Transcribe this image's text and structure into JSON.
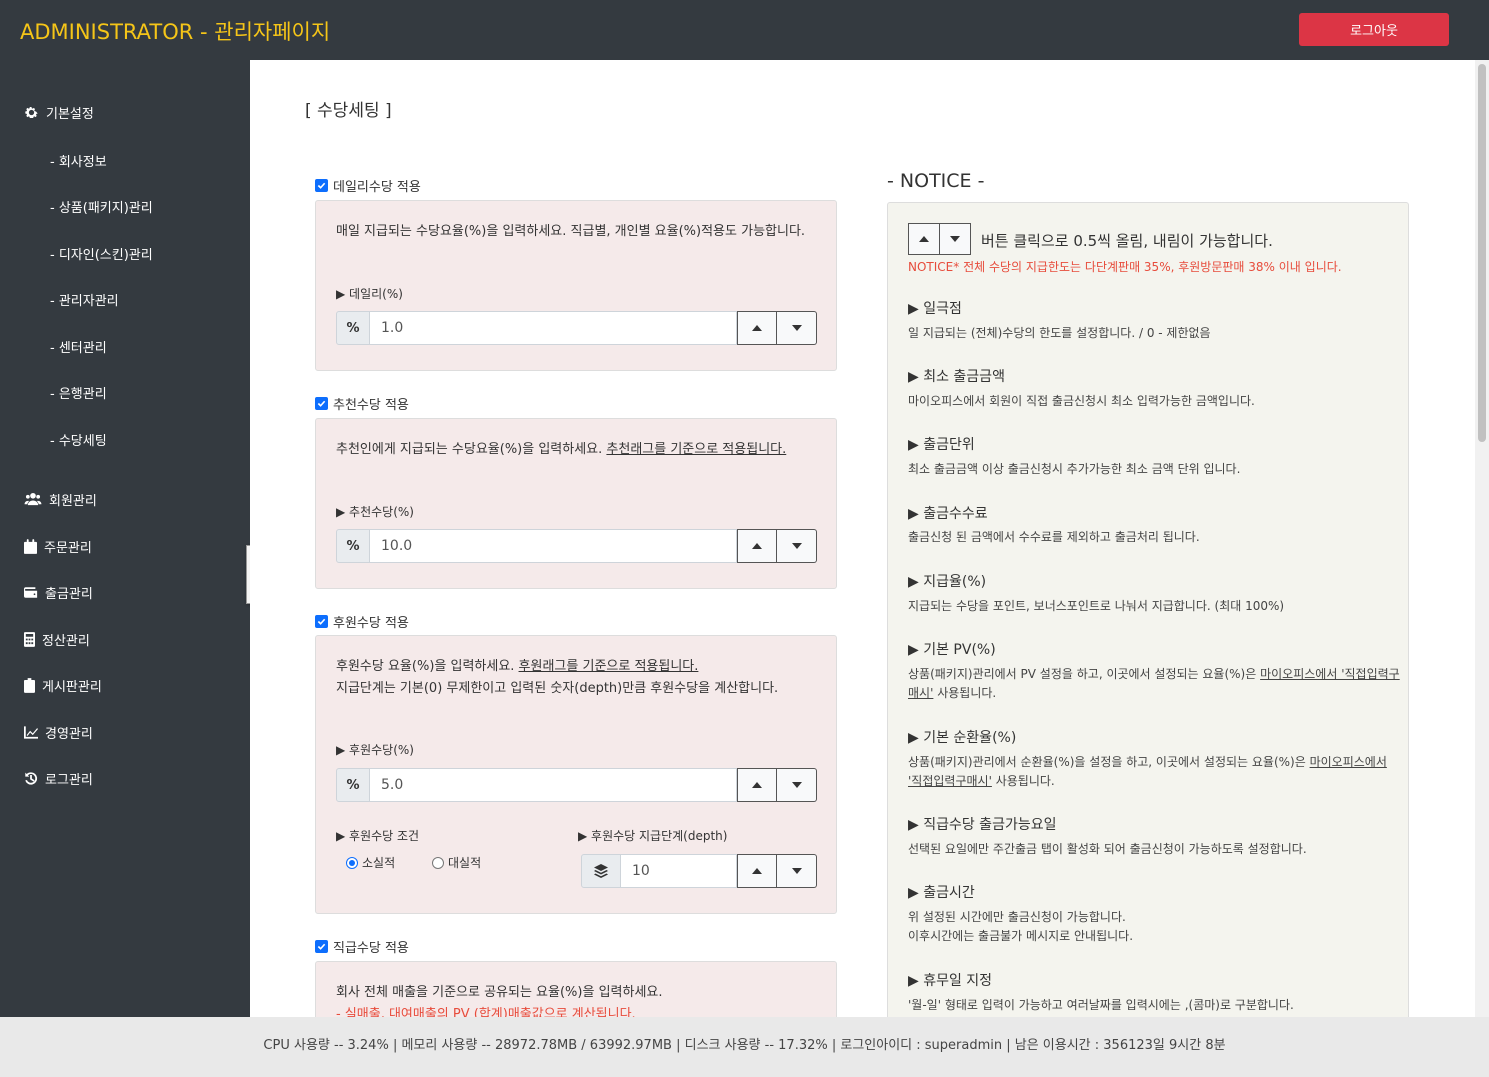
{
  "header": {
    "brand": "ADMINISTRATOR - 관리자페이지",
    "logout_label": "로그아웃"
  },
  "sidebar": {
    "groups": [
      {
        "label": "기본설정",
        "icon": "gear-icon"
      },
      {
        "label": "회원관리",
        "icon": "users-icon"
      },
      {
        "label": "주문관리",
        "icon": "calendar-icon"
      },
      {
        "label": "출금관리",
        "icon": "wallet-icon"
      },
      {
        "label": "정산관리",
        "icon": "calculator-icon"
      },
      {
        "label": "게시판관리",
        "icon": "clipboard-icon"
      },
      {
        "label": "경영관리",
        "icon": "chart-line-icon"
      },
      {
        "label": "로그관리",
        "icon": "history-icon"
      }
    ],
    "sub_items": [
      "- 회사정보",
      "- 상품(패키지)관리",
      "- 디자인(스킨)관리",
      "- 관리자관리",
      "- 센터관리",
      "- 은행관리",
      "- 수당세팅"
    ]
  },
  "page": {
    "title": "[ 수당세팅 ]"
  },
  "daily": {
    "checkbox_label": "데일리수당 적용",
    "desc": "매일 지급되는 수당요율(%)을 입력하세요. 직급별, 개인별 요율(%)적용도 가능합니다.",
    "field_label": "▶ 데일리(%)",
    "value": "1.0"
  },
  "referral": {
    "checkbox_label": "추천수당 적용",
    "desc_plain": "추천인에게 지급되는 수당요율(%)을 입력하세요. ",
    "desc_underline": "추천래그를 기준으로 적용됩니다.",
    "field_label": "▶ 추천수당(%)",
    "value": "10.0"
  },
  "sponsor": {
    "checkbox_label": "후원수당 적용",
    "desc_plain": "후원수당 요율(%)을 입력하세요. ",
    "desc_underline": "후원래그를 기준으로 적용됩니다.",
    "desc_line2": "지급단계는 기본(0) 무제한이고 입력된 숫자(depth)만큼 후원수당을 계산합니다.",
    "field_label": "▶ 후원수당(%)",
    "value": "5.0",
    "condition_label": "▶ 후원수당 조건",
    "radio_small": "소실적",
    "radio_large": "대실적",
    "selected": "소실적",
    "depth_label": "▶ 후원수당 지급단계(depth)",
    "depth_value": "10"
  },
  "rank": {
    "checkbox_label": "직급수당 적용",
    "desc": "회사 전체 매출을 기준으로 공유되는 요율(%)을 입력하세요.",
    "desc_red": "- 실매출, 대여매출의 PV (합계)매출값으로 계산됩니다."
  },
  "notice": {
    "title": "- NOTICE -",
    "intro": "버튼 클릭으로 0.5씩 올림, 내림이 가능합니다.",
    "warning": "NOTICE* 전체 수당의 지급한도는 다단계판매 35%, 후원방문판매 38% 이내 입니다.",
    "items": [
      {
        "head": "▶ 일극점",
        "text": "일 지급되는 (전체)수당의 한도를 설정합니다. / 0 - 제한없음"
      },
      {
        "head": "▶ 최소 출금금액",
        "text": "마이오피스에서 회원이 직접 출금신청시 최소 입력가능한 금액입니다."
      },
      {
        "head": "▶ 출금단위",
        "text": "최소 출금금액 이상 출금신청시 추가가능한 최소 금액 단위 입니다."
      },
      {
        "head": "▶ 출금수수료",
        "text": "출금신청 된 금액에서 수수료를 제외하고 출금처리 됩니다."
      },
      {
        "head": "▶ 지급율(%)",
        "text": "지급되는 수당을 포인트, 보너스포인트로 나눠서 지급합니다. (최대 100%)"
      },
      {
        "head": "▶ 기본 PV(%)",
        "text": "상품(패키지)관리에서 PV 설정을 하고, 이곳에서 설정되는 요율(%)은 ",
        "underline": "마이오피스에서 '직접입력구매시'",
        "tail": " 사용됩니다."
      },
      {
        "head": "▶ 기본 순환율(%)",
        "text": "상품(패키지)관리에서 순환율(%)을 설정을 하고, 이곳에서 설정되는 요율(%)은 ",
        "underline": "마이오피스에서 '직접입력구매시'",
        "tail": " 사용됩니다."
      },
      {
        "head": "▶ 직급수당 출금가능요일",
        "text": "선택된 요일에만 주간출금 탭이 활성화 되어 출금신청이 가능하도록 설정합니다."
      },
      {
        "head": "▶ 출금시간",
        "text": "위 설정된 시간에만 출금신청이 가능합니다.",
        "text2": "이후시간에는 출금불가 메시지로 안내됩니다."
      },
      {
        "head": "▶ 휴무일 지정",
        "text": "'월-일' 형태로 입력이 가능하고 여러날짜를 입력시에는 ,(콤마)로 구분합니다."
      }
    ]
  },
  "footer": {
    "status": "CPU 사용량 -- 3.24% | 메모리 사용량 -- 28972.78MB / 63992.97MB | 디스크 사용량 -- 17.32%  |   로그인아이디 : superadmin  |   남은 이용시간 : 356123일 9시간 8분"
  },
  "icons": {
    "percent_addon": "percent-icon",
    "depth_addon": "layers-icon",
    "spin_up": "caret-up-icon",
    "spin_down": "caret-down-icon",
    "collapse": "chevron-left-icon"
  },
  "colors": {
    "sidebar_bg": "#343a40",
    "brand": "#f5c518",
    "logout": "#dc3545",
    "panel_bg": "#f5eaea",
    "notice_bg": "#f4f4ee",
    "warning": "#e74c3c",
    "checkbox": "#0d6efd"
  }
}
